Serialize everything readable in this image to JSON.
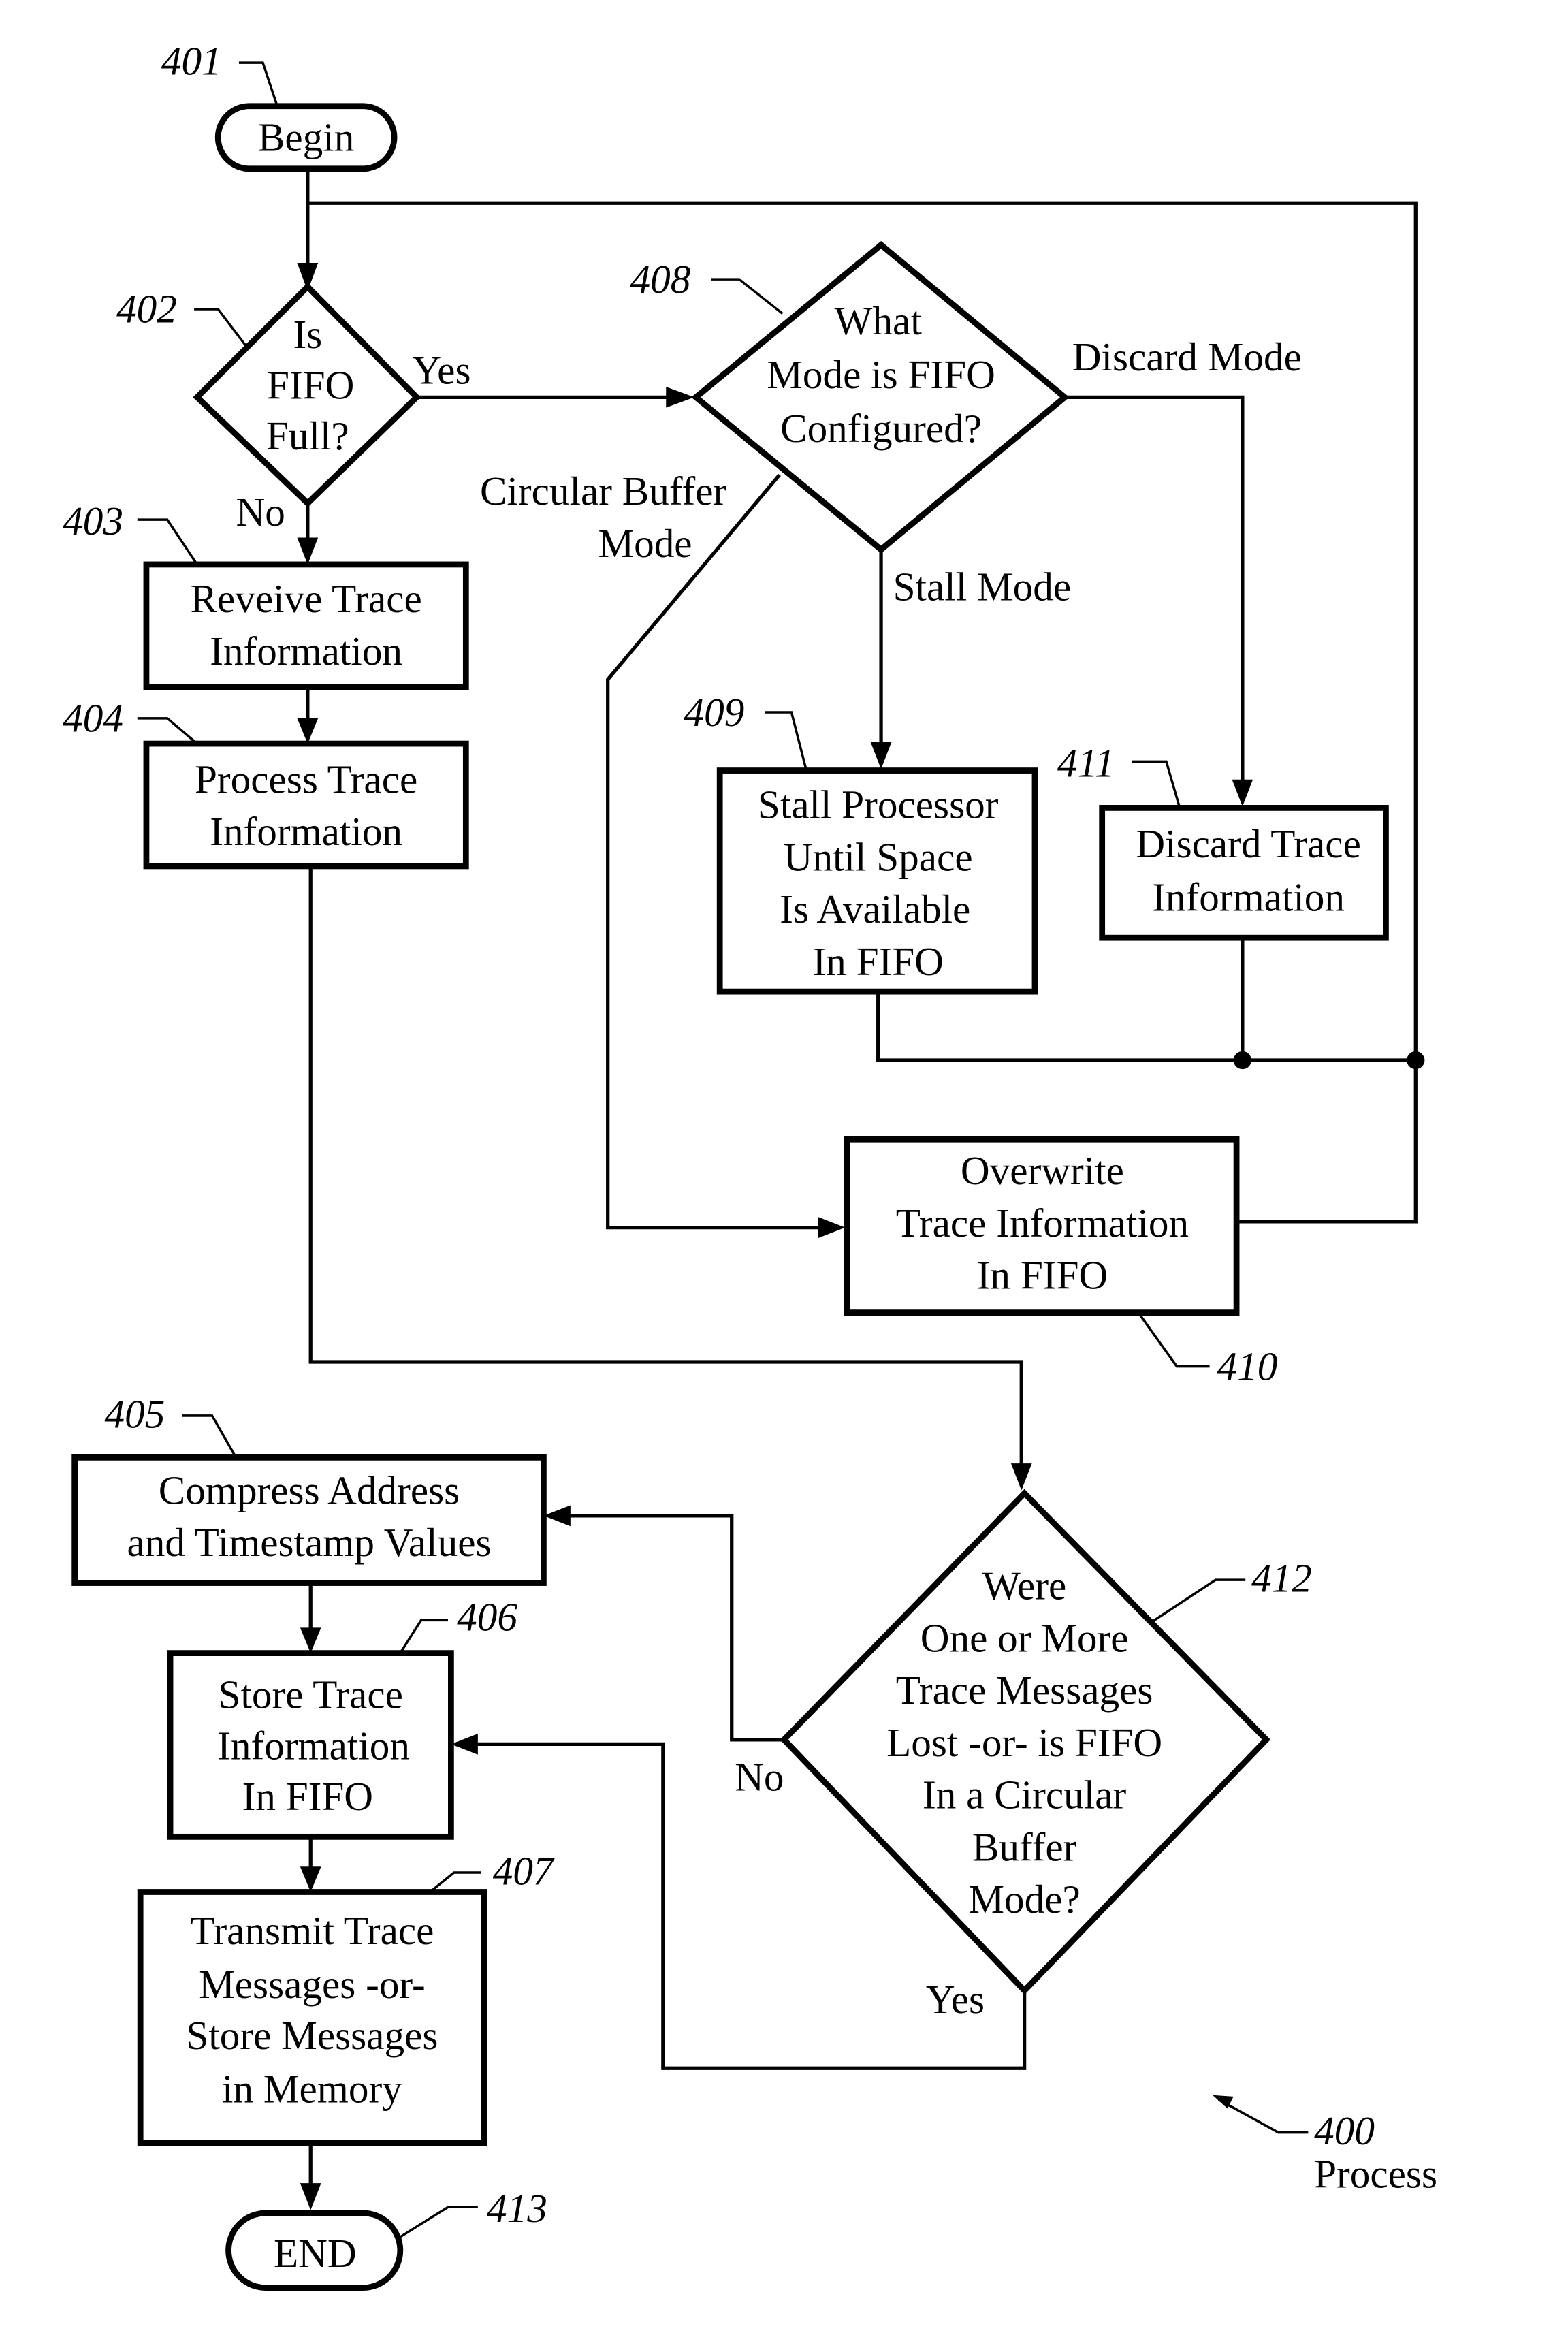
{
  "figure": {
    "ref": "400",
    "caption": "Process"
  },
  "nodes": {
    "n401": {
      "ref": "401",
      "lines": [
        "Begin"
      ]
    },
    "n402": {
      "ref": "402",
      "lines": [
        "Is",
        "FIFO",
        "Full?"
      ]
    },
    "n403": {
      "ref": "403",
      "lines": [
        "Reveive Trace",
        "Information"
      ]
    },
    "n404": {
      "ref": "404",
      "lines": [
        "Process Trace",
        "Information"
      ]
    },
    "n405": {
      "ref": "405",
      "lines": [
        "Compress Address",
        "and Timestamp Values"
      ]
    },
    "n406": {
      "ref": "406",
      "lines": [
        "Store Trace",
        "Information",
        "In FIFO"
      ]
    },
    "n407": {
      "ref": "407",
      "lines": [
        "Transmit Trace",
        "Messages -or-",
        "Store Messages",
        "in Memory"
      ]
    },
    "n408": {
      "ref": "408",
      "lines": [
        "What",
        "Mode is FIFO",
        "Configured?"
      ]
    },
    "n409": {
      "ref": "409",
      "lines": [
        "Stall Processor",
        "Until Space",
        "Is Available",
        "In FIFO"
      ]
    },
    "n410": {
      "ref": "410",
      "lines": [
        "Overwrite",
        "Trace Information",
        "In FIFO"
      ]
    },
    "n411": {
      "ref": "411",
      "lines": [
        "Discard Trace",
        "Information"
      ]
    },
    "n412": {
      "ref": "412",
      "lines": [
        "Were",
        "One or More",
        "Trace Messages",
        "Lost -or- is FIFO",
        "In a Circular",
        "Buffer",
        "Mode?"
      ]
    },
    "n413": {
      "ref": "413",
      "lines": [
        "END"
      ]
    }
  },
  "edge_labels": {
    "yes_402": "Yes",
    "no_402": "No",
    "discard_mode": "Discard Mode",
    "circular_buffer_mode": [
      "Circular Buffer",
      "Mode"
    ],
    "stall_mode": "Stall Mode",
    "no_412": "No",
    "yes_412": "Yes"
  }
}
